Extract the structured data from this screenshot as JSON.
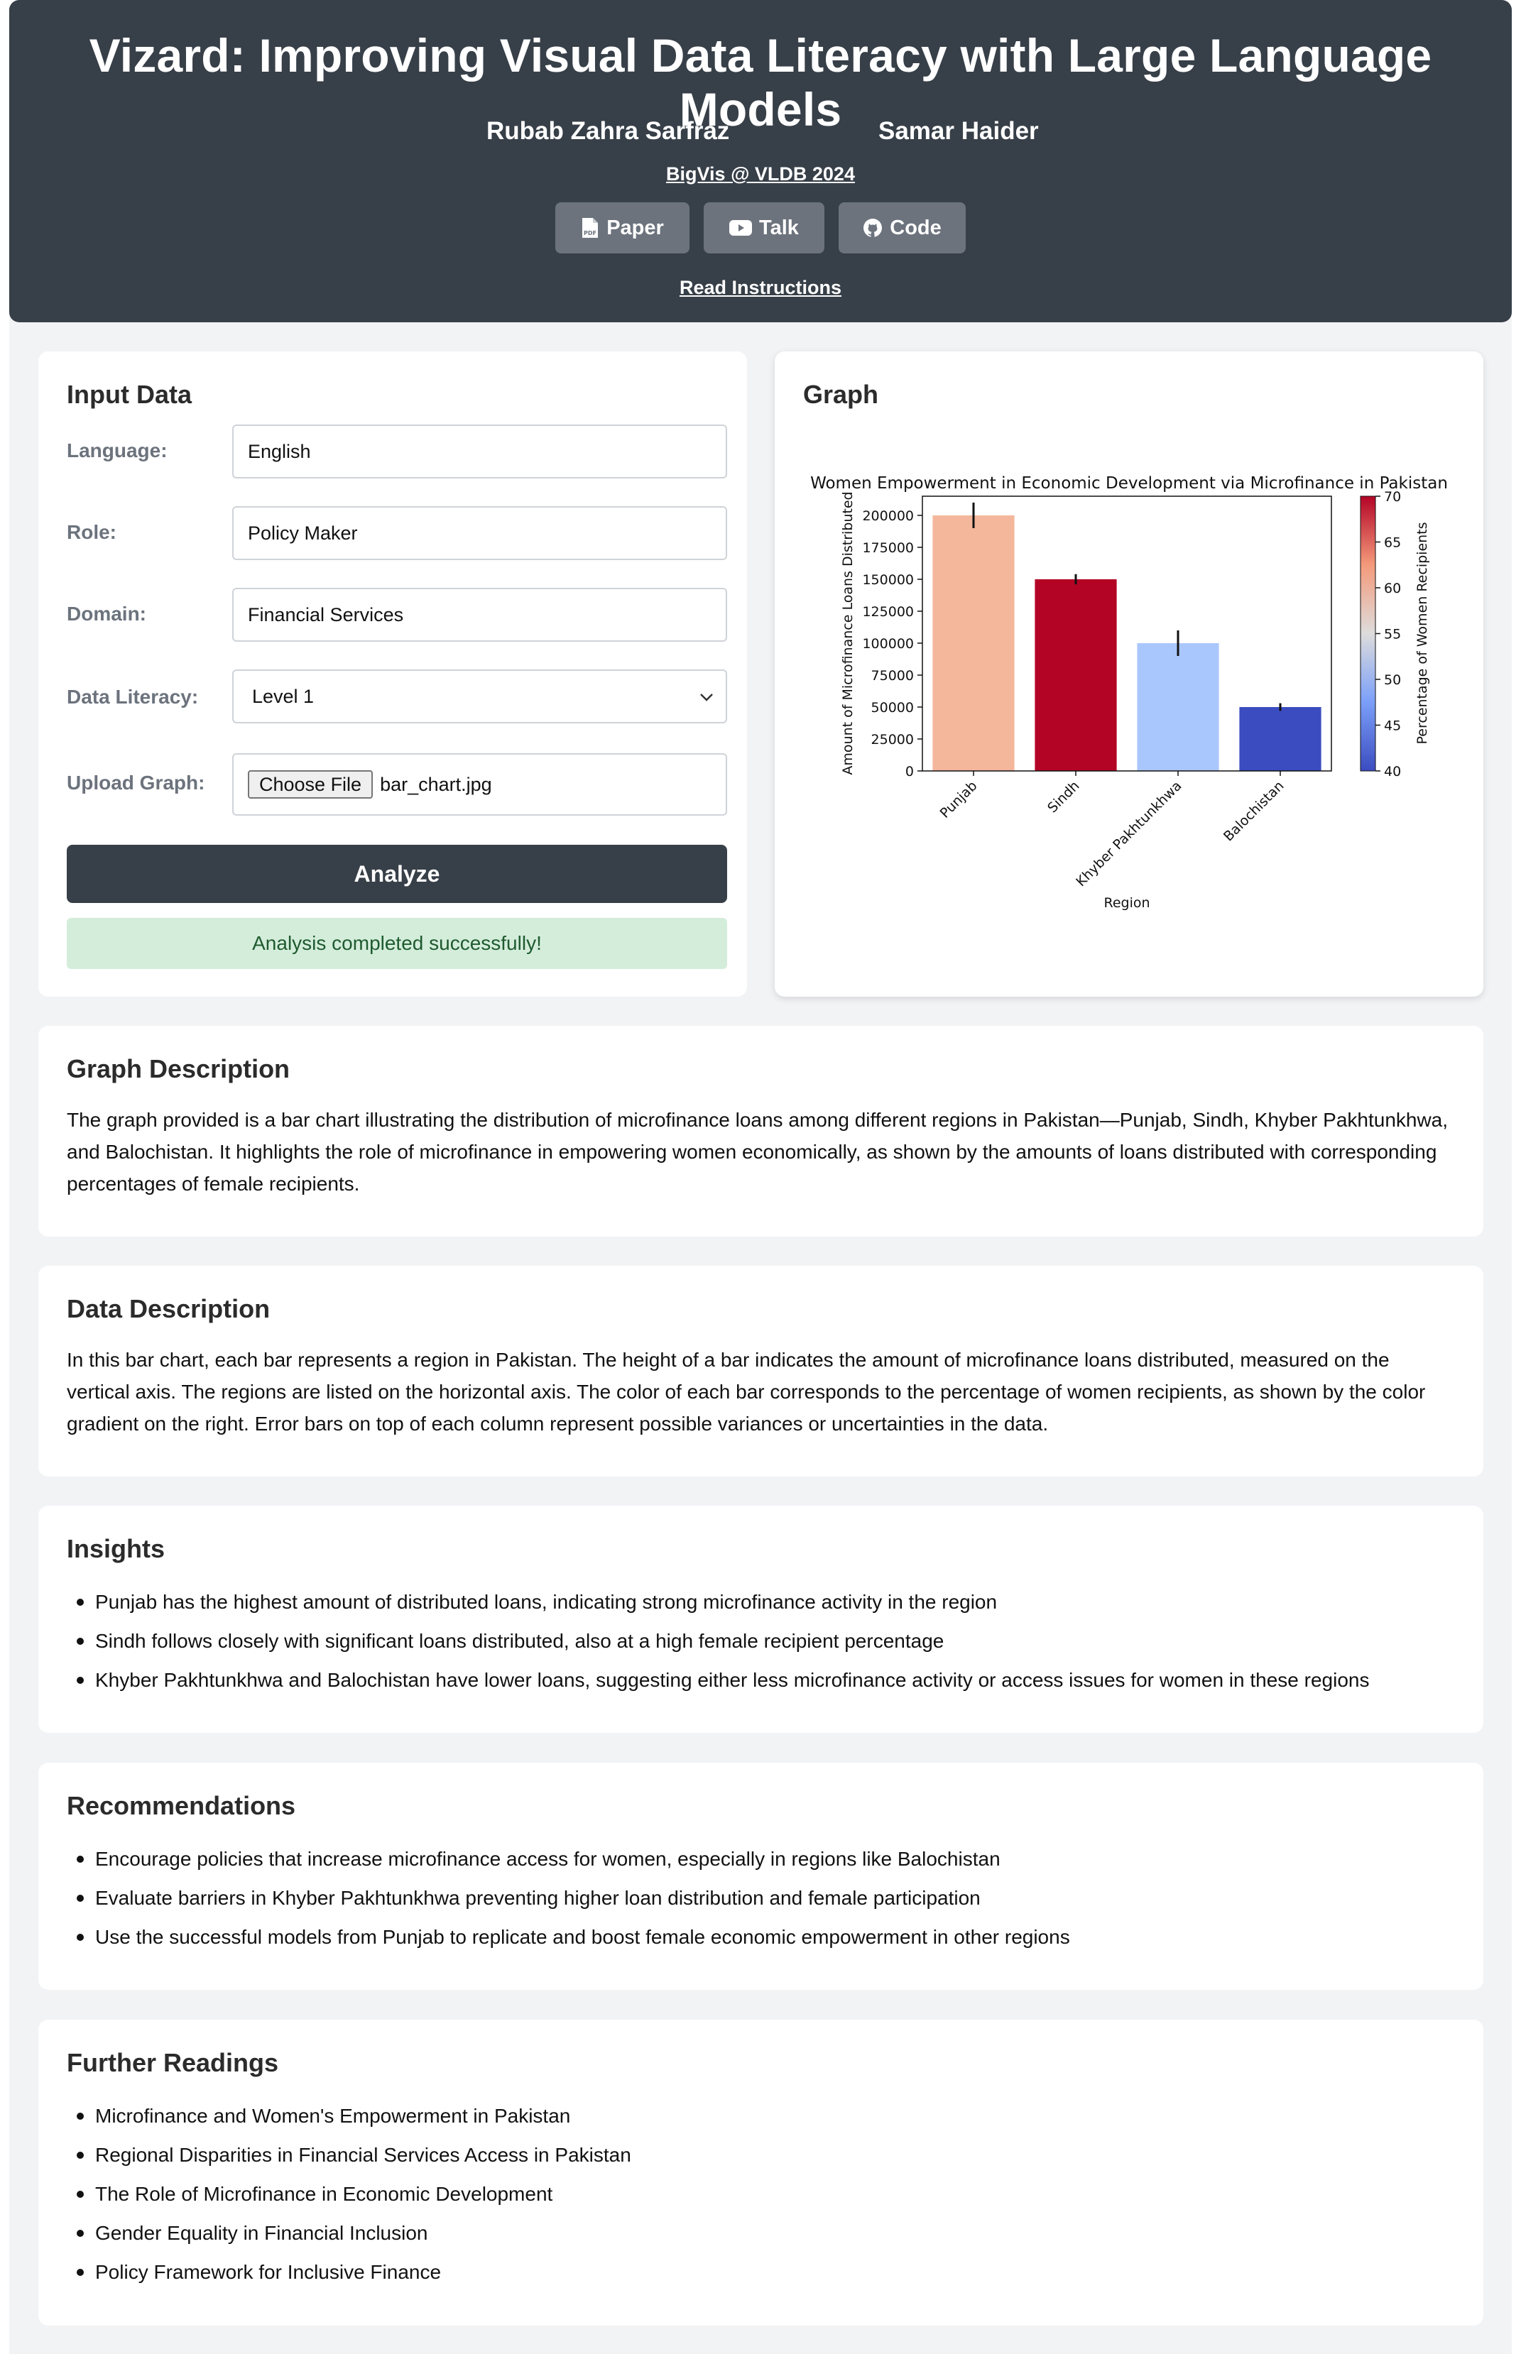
{
  "header": {
    "title": "Vizard: Improving Visual Data Literacy with Large Language Models",
    "authors": [
      "Rubab Zahra Sarfraz",
      "Samar Haider"
    ],
    "venue": "BigVis @ VLDB 2024",
    "buttons": [
      {
        "label": "Paper",
        "icon": "pdf-icon"
      },
      {
        "label": "Talk",
        "icon": "youtube-icon"
      },
      {
        "label": "Code",
        "icon": "github-icon"
      }
    ],
    "instructions_link": "Read Instructions"
  },
  "input_panel": {
    "heading": "Input Data",
    "fields": {
      "language": {
        "label": "Language:",
        "value": "English"
      },
      "role": {
        "label": "Role:",
        "value": "Policy Maker"
      },
      "domain": {
        "label": "Domain:",
        "value": "Financial Services"
      },
      "data_literacy": {
        "label": "Data Literacy:",
        "value": "Level 1"
      },
      "upload": {
        "label": "Upload Graph:",
        "button": "Choose File",
        "filename": "bar_chart.jpg"
      }
    },
    "analyze_label": "Analyze",
    "status": "Analysis completed successfully!"
  },
  "graph_panel": {
    "heading": "Graph"
  },
  "chart_data": {
    "type": "bar",
    "title": "Women Empowerment in Economic Development via Microfinance in Pakistan",
    "xlabel": "Region",
    "ylabel": "Amount of Microfinance Loans Distributed",
    "categories": [
      "Punjab",
      "Sindh",
      "Khyber Pakhtunkhwa",
      "Balochistan"
    ],
    "values": [
      200000,
      150000,
      100000,
      50000
    ],
    "error": [
      10000,
      4000,
      10000,
      3000
    ],
    "colors": [
      "#f4b79c",
      "#b40426",
      "#aac7fd",
      "#3b4cc0"
    ],
    "ylim": [
      0,
      215000
    ],
    "yticks": [
      0,
      25000,
      50000,
      75000,
      100000,
      125000,
      150000,
      175000,
      200000
    ],
    "colorbar": {
      "label": "Percentage of Women Recipients",
      "range": [
        40,
        70
      ],
      "ticks": [
        40,
        45,
        50,
        55,
        60,
        65,
        70
      ],
      "colormap": "coolwarm"
    },
    "grid": false
  },
  "sections": {
    "graph_description": {
      "heading": "Graph Description",
      "text": "The graph provided is a bar chart illustrating the distribution of microfinance loans among different regions in Pakistan—Punjab, Sindh, Khyber Pakhtunkhwa, and Balochistan. It highlights the role of microfinance in empowering women economically, as shown by the amounts of loans distributed with corresponding percentages of female recipients."
    },
    "data_description": {
      "heading": "Data Description",
      "text": "In this bar chart, each bar represents a region in Pakistan. The height of a bar indicates the amount of microfinance loans distributed, measured on the vertical axis. The regions are listed on the horizontal axis. The color of each bar corresponds to the percentage of women recipients, as shown by the color gradient on the right. Error bars on top of each column represent possible variances or uncertainties in the data."
    },
    "insights": {
      "heading": "Insights",
      "items": [
        "Punjab has the highest amount of distributed loans, indicating strong microfinance activity in the region",
        "Sindh follows closely with significant loans distributed, also at a high female recipient percentage",
        "Khyber Pakhtunkhwa and Balochistan have lower loans, suggesting either less microfinance activity or access issues for women in these regions"
      ]
    },
    "recommendations": {
      "heading": "Recommendations",
      "items": [
        "Encourage policies that increase microfinance access for women, especially in regions like Balochistan",
        "Evaluate barriers in Khyber Pakhtunkhwa preventing higher loan distribution and female participation",
        "Use the successful models from Punjab to replicate and boost female economic empowerment in other regions"
      ]
    },
    "further_readings": {
      "heading": "Further Readings",
      "items": [
        "Microfinance and Women's Empowerment in Pakistan",
        "Regional Disparities in Financial Services Access in Pakistan",
        "The Role of Microfinance in Economic Development",
        "Gender Equality in Financial Inclusion",
        "Policy Framework for Inclusive Finance"
      ]
    }
  }
}
